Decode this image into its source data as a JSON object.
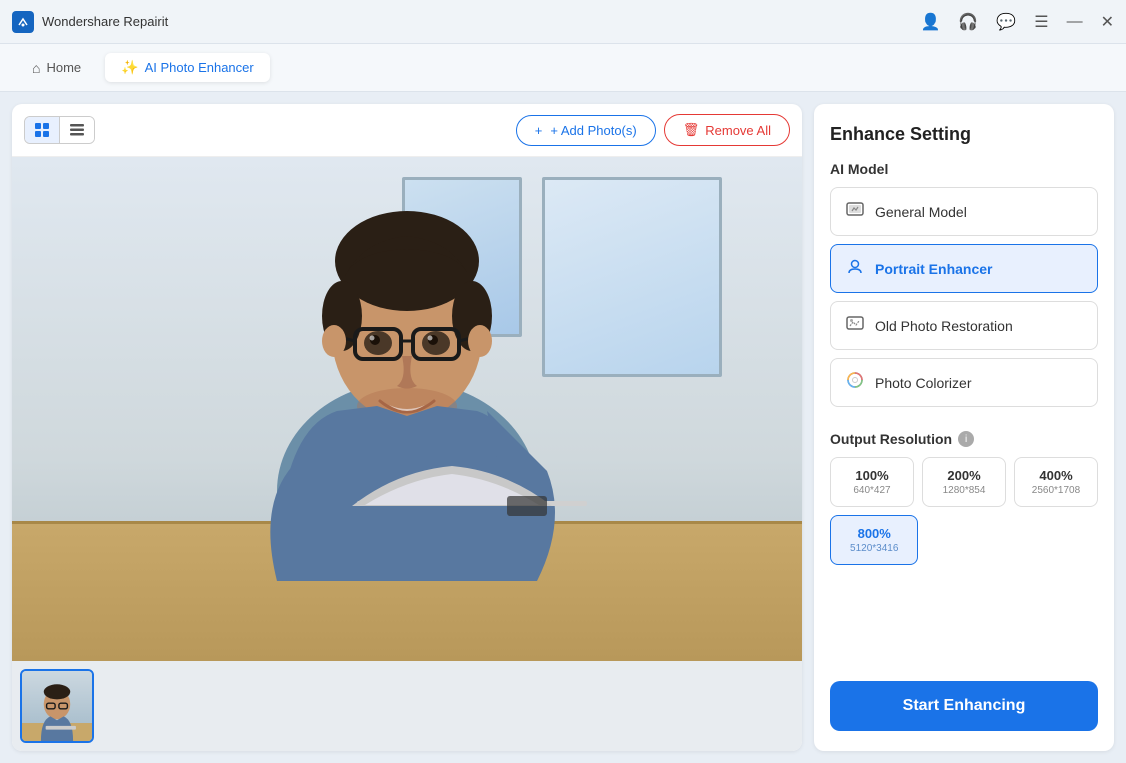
{
  "titleBar": {
    "appName": "Wondershare Repairit",
    "icons": [
      "user-icon",
      "headphone-icon",
      "chat-icon",
      "menu-icon",
      "minimize-icon",
      "close-icon"
    ]
  },
  "navBar": {
    "tabs": [
      {
        "id": "home",
        "label": "Home",
        "icon": "home-icon",
        "active": false
      },
      {
        "id": "ai-photo",
        "label": "AI Photo Enhancer",
        "icon": "ai-icon",
        "active": true
      }
    ]
  },
  "toolbar": {
    "addPhotos": "+ Add Photo(s)",
    "removeAll": "Remove All"
  },
  "rightPanel": {
    "title": "Enhance Setting",
    "aiModelSection": "AI Model",
    "models": [
      {
        "id": "general",
        "label": "General Model",
        "icon": "🖼",
        "active": false
      },
      {
        "id": "portrait",
        "label": "Portrait Enhancer",
        "icon": "👤",
        "active": true
      },
      {
        "id": "old-photo",
        "label": "Old Photo Restoration",
        "icon": "🖼",
        "active": false
      },
      {
        "id": "colorizer",
        "label": "Photo Colorizer",
        "icon": "🎨",
        "active": false
      }
    ],
    "outputResolution": "Output Resolution",
    "resolutions": [
      {
        "id": "100",
        "label": "100%",
        "sub": "640*427",
        "active": false
      },
      {
        "id": "200",
        "label": "200%",
        "sub": "1280*854",
        "active": false
      },
      {
        "id": "400",
        "label": "400%",
        "sub": "2560*1708",
        "active": false
      },
      {
        "id": "800",
        "label": "800%",
        "sub": "5120*3416",
        "active": true
      }
    ],
    "startButton": "Start Enhancing"
  }
}
